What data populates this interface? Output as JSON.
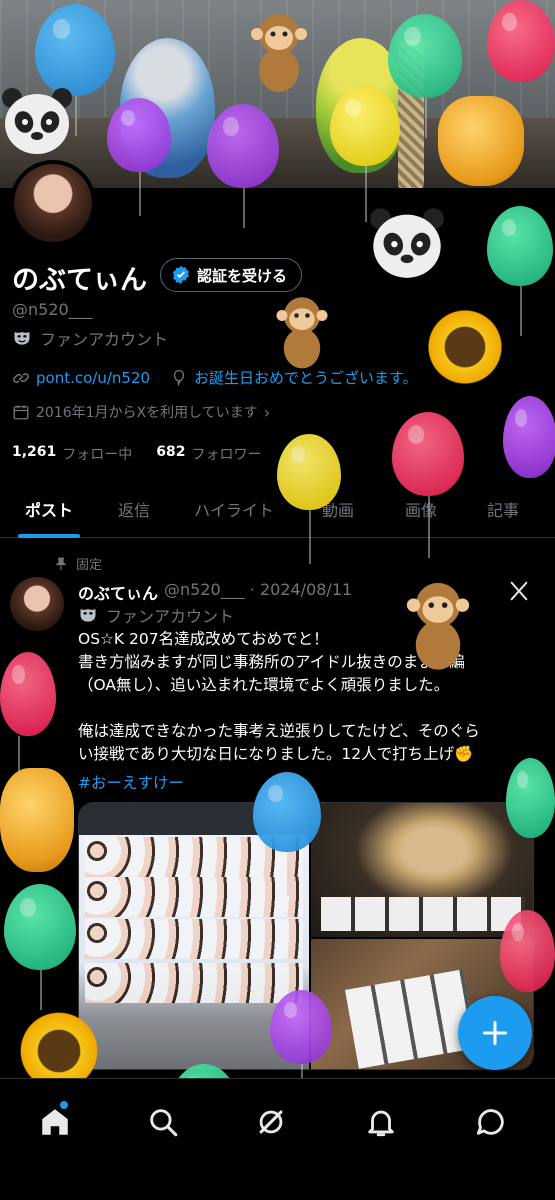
{
  "profile": {
    "name": "のぶてぃん",
    "verify_label": "認証を受ける",
    "handle": "@n520___",
    "category": "ファンアカウント",
    "link": "pont.co/u/n520",
    "birthday": "お誕生日おめでとうございます。",
    "joined": "2016年1月からXを利用しています",
    "following_count": "1,261",
    "following_label": "フォロー中",
    "followers_count": "682",
    "followers_label": "フォロワー"
  },
  "tabs": [
    "ポスト",
    "返信",
    "ハイライト",
    "動画",
    "画像",
    "記事"
  ],
  "pinned_label": "固定",
  "tweet": {
    "name": "のぶてぃん",
    "handle_date": "@n520___ · 2024/08/11",
    "category": "ファンアカウント",
    "lines": [
      "OS☆K 207名達成改めておめでと！",
      "書き方悩みますが同じ事務所のアイドル抜きのまま本編",
      "（OA無し）、追い込まれた環境でよく頑張りました。",
      "",
      "俺は達成できなかった事考え逆張りしてたけど、そのぐら",
      "い接戦であり大切な日になりました。12人で打ち上げ✊"
    ],
    "hashtag": "#おーえすけー"
  },
  "icons": {
    "verify": "verified-badge-icon",
    "category": "mask-icon",
    "link": "link-icon",
    "birthday": "balloon-icon",
    "calendar": "calendar-icon",
    "pin": "pin-icon",
    "grok": "grok-icon",
    "compose": "plus-icon",
    "nav": [
      "home-icon",
      "search-icon",
      "grok-icon",
      "notifications-icon",
      "messages-icon"
    ]
  },
  "colors": {
    "accent": "#1d9bf0",
    "background": "#000000",
    "text": "#e7e9ea",
    "secondary": "#71767b"
  }
}
